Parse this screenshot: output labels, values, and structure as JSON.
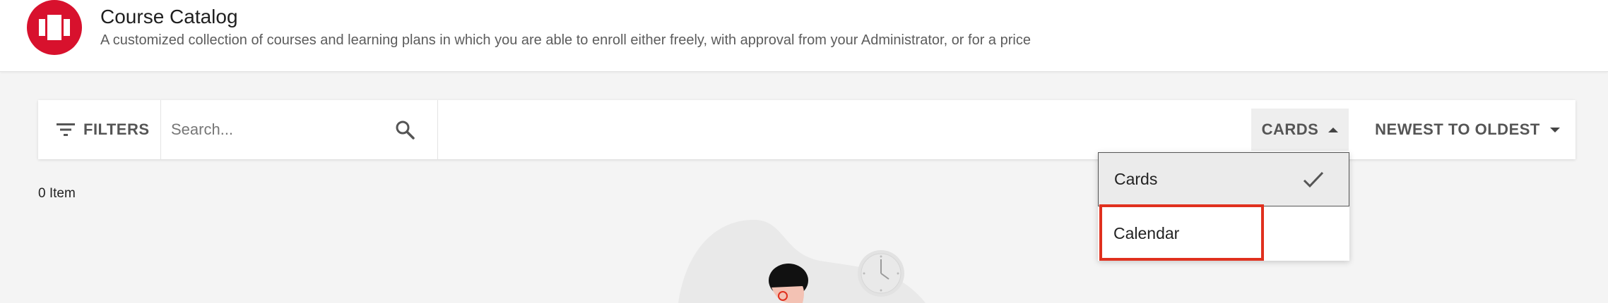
{
  "header": {
    "title": "Course Catalog",
    "subtitle": "A customized collection of courses and learning plans in which you are able to enroll either freely, with approval from your Administrator, or for a price",
    "logo_icon": "catalog-icon",
    "brand_color": "#d8112d"
  },
  "toolbar": {
    "filters_label": "FILTERS",
    "filters_icon": "filter-icon",
    "search_placeholder": "Search...",
    "search_value": "",
    "search_icon": "search-icon",
    "view_label": "CARDS",
    "view_icon": "caret-up-icon",
    "sort_label": "NEWEST TO OLDEST",
    "sort_icon": "caret-down-icon"
  },
  "results": {
    "count_label": "0 Item"
  },
  "view_dropdown": {
    "options": [
      {
        "label": "Cards",
        "selected": true,
        "icon": "checkmark-icon"
      },
      {
        "label": "Calendar",
        "selected": false,
        "highlighted": true
      }
    ],
    "highlight_color": "#e0301e"
  },
  "empty_state": {
    "illustration_icon": "person-with-clock-illustration"
  }
}
